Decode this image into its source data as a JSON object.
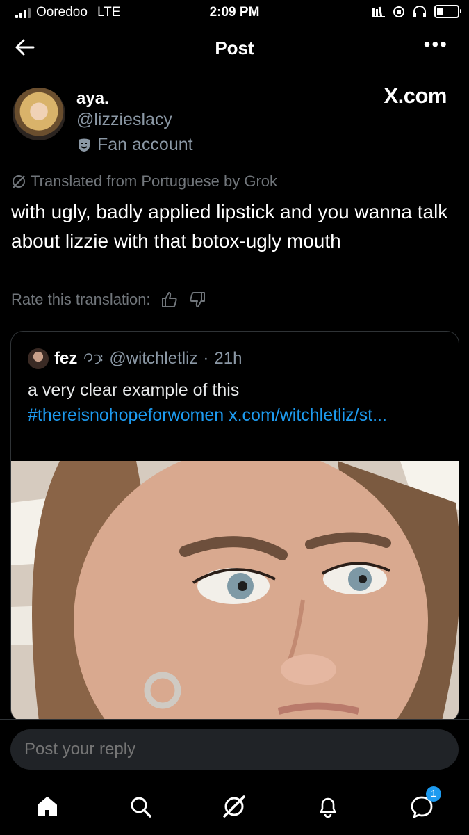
{
  "status_bar": {
    "carrier": "Ooredoo",
    "network": "LTE",
    "time": "2:09 PM"
  },
  "header": {
    "title": "Post",
    "more_label": "•••"
  },
  "post": {
    "display_name": "aya.",
    "handle": "@lizzieslacy",
    "badge_text": "Fan account",
    "source_label": "X.com",
    "translation_note": "Translated from Portuguese by Grok",
    "text": "with ugly, badly applied lipstick and you wanna talk about lizzie with that botox-ugly mouth",
    "rate_label": "Rate this translation:"
  },
  "quote": {
    "display_name": "fez",
    "handle": "@witchletliz",
    "separator": "·",
    "time": "21h",
    "text_plain": "a very clear example of this",
    "hashtag": "#thereisnohopeforwomen",
    "link": "x.com/witchletliz/st..."
  },
  "reply": {
    "placeholder": "Post your reply"
  },
  "tabs": [
    {
      "name": "home"
    },
    {
      "name": "search"
    },
    {
      "name": "grok"
    },
    {
      "name": "notifications"
    },
    {
      "name": "messages",
      "badge": "1"
    }
  ],
  "colors": {
    "accent": "#1d9bf0",
    "muted": "#71767b",
    "background": "#000000"
  }
}
